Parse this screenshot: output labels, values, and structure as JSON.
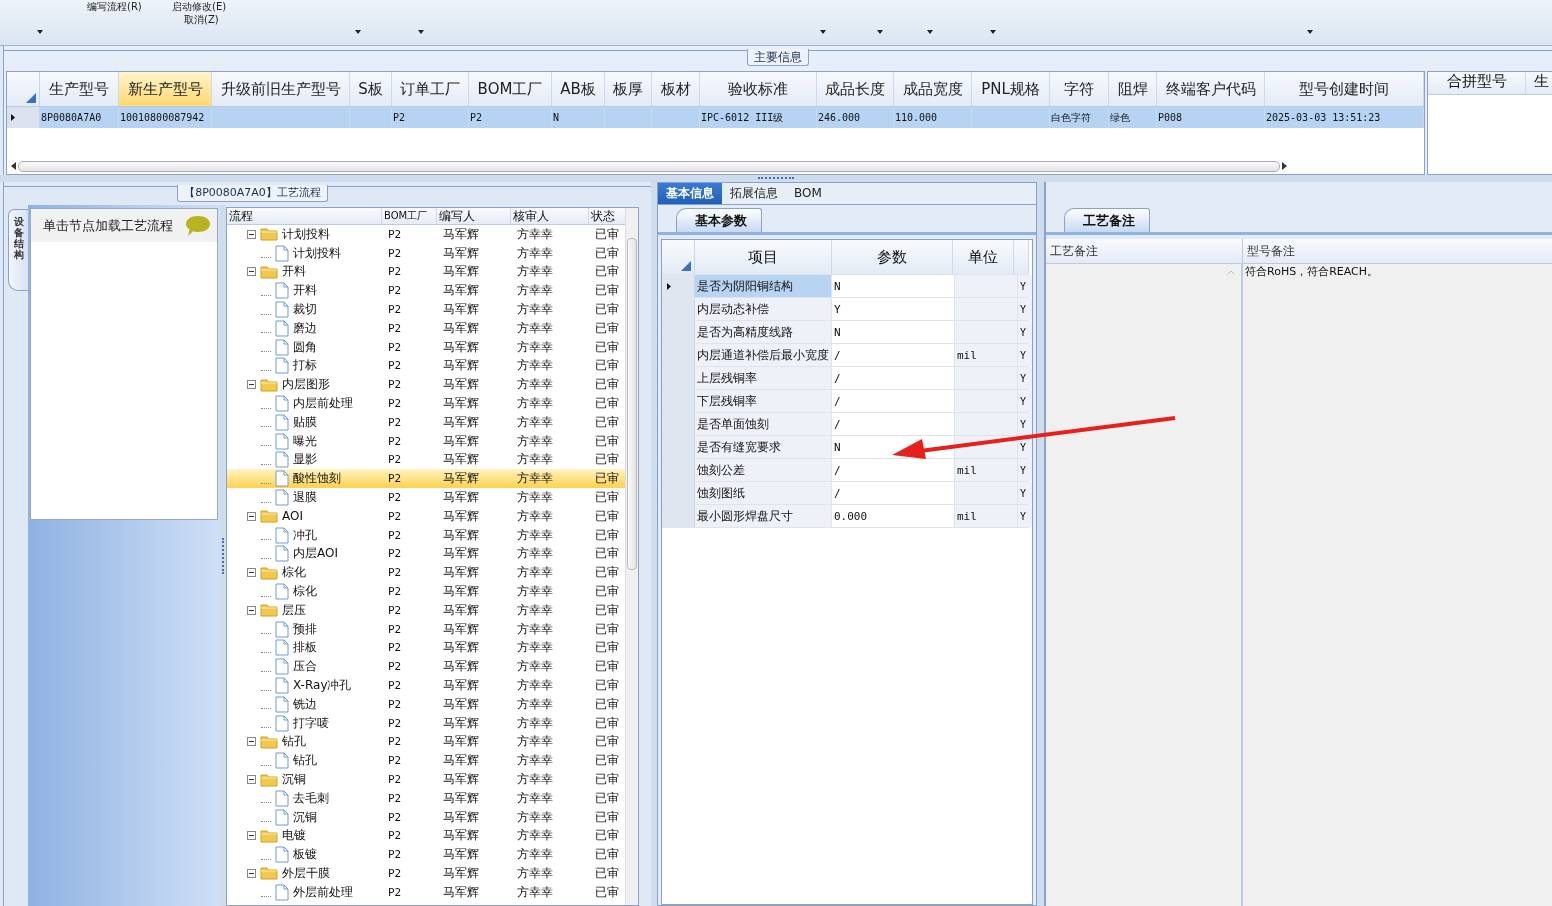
{
  "toolbar": {
    "items": [
      {
        "label": "编写流程(R)"
      },
      {
        "label": "启动修改(E)"
      },
      {
        "label": "取消(Z)"
      }
    ]
  },
  "main_info": {
    "title": "主要信息",
    "columns": [
      {
        "label": "生产型号",
        "selected": false
      },
      {
        "label": "新生产型号",
        "selected": true
      },
      {
        "label": "升级前旧生产型号",
        "selected": false
      },
      {
        "label": "S板",
        "selected": false
      },
      {
        "label": "订单工厂",
        "selected": false
      },
      {
        "label": "BOM工厂",
        "selected": false
      },
      {
        "label": "AB板",
        "selected": false
      },
      {
        "label": "板厚",
        "selected": false
      },
      {
        "label": "板材",
        "selected": false
      },
      {
        "label": "验收标准",
        "selected": false
      },
      {
        "label": "成品长度",
        "selected": false
      },
      {
        "label": "成品宽度",
        "selected": false
      },
      {
        "label": "PNL规格",
        "selected": false
      },
      {
        "label": "字符",
        "selected": false
      },
      {
        "label": "阻焊",
        "selected": false
      },
      {
        "label": "终端客户代码",
        "selected": false
      },
      {
        "label": "型号创建时间",
        "selected": false
      }
    ],
    "rows": [
      {
        "selected": true,
        "cells": [
          "8P0080A7A0",
          "10010800087942",
          null,
          null,
          "P2",
          "P2",
          "N",
          null,
          null,
          "IPC-6012 III级",
          "246.000",
          "110.000",
          null,
          "白色字符",
          "绿色",
          "P008",
          "2025-03-03 13:51:23"
        ]
      }
    ],
    "side_columns": [
      "合拼型号",
      "生"
    ]
  },
  "process_panel": {
    "title": "【8P0080A7A0】工艺流程",
    "side_tab": "设备结构",
    "hint": "单击节点加载工艺流程",
    "tree": {
      "columns": [
        "流程",
        "BOM工厂",
        "编写人",
        "核审人",
        "状态"
      ],
      "rows": [
        {
          "name": "计划投料",
          "bom_factory": "P2",
          "author": "马军辉",
          "reviewer": "方幸幸",
          "status": "已审",
          "selected": false,
          "expanded": true,
          "children": [
            {
              "name": "计划投料",
              "bom_factory": "P2",
              "author": "马军辉",
              "reviewer": "方幸幸",
              "status": "已审",
              "selected": false
            }
          ]
        },
        {
          "name": "开料",
          "bom_factory": "P2",
          "author": "马军辉",
          "reviewer": "方幸幸",
          "status": "已审",
          "selected": false,
          "expanded": true,
          "children": [
            {
              "name": "开料",
              "bom_factory": "P2",
              "author": "马军辉",
              "reviewer": "方幸幸",
              "status": "已审",
              "selected": false
            },
            {
              "name": "裁切",
              "bom_factory": "P2",
              "author": "马军辉",
              "reviewer": "方幸幸",
              "status": "已审",
              "selected": false
            },
            {
              "name": "磨边",
              "bom_factory": "P2",
              "author": "马军辉",
              "reviewer": "方幸幸",
              "status": "已审",
              "selected": false
            },
            {
              "name": "圆角",
              "bom_factory": "P2",
              "author": "马军辉",
              "reviewer": "方幸幸",
              "status": "已审",
              "selected": false
            },
            {
              "name": "打标",
              "bom_factory": "P2",
              "author": "马军辉",
              "reviewer": "方幸幸",
              "status": "已审",
              "selected": false
            }
          ]
        },
        {
          "name": "内层图形",
          "bom_factory": "P2",
          "author": "马军辉",
          "reviewer": "方幸幸",
          "status": "已审",
          "selected": false,
          "expanded": true,
          "children": [
            {
              "name": "内层前处理",
              "bom_factory": "P2",
              "author": "马军辉",
              "reviewer": "方幸幸",
              "status": "已审",
              "selected": false
            },
            {
              "name": "贴膜",
              "bom_factory": "P2",
              "author": "马军辉",
              "reviewer": "方幸幸",
              "status": "已审",
              "selected": false
            },
            {
              "name": "曝光",
              "bom_factory": "P2",
              "author": "马军辉",
              "reviewer": "方幸幸",
              "status": "已审",
              "selected": false
            },
            {
              "name": "显影",
              "bom_factory": "P2",
              "author": "马军辉",
              "reviewer": "方幸幸",
              "status": "已审",
              "selected": false
            },
            {
              "name": "酸性蚀刻",
              "bom_factory": "P2",
              "author": "马军辉",
              "reviewer": "方幸幸",
              "status": "已审",
              "selected": true
            },
            {
              "name": "退膜",
              "bom_factory": "P2",
              "author": "马军辉",
              "reviewer": "方幸幸",
              "status": "已审",
              "selected": false
            }
          ]
        },
        {
          "name": "AOI",
          "bom_factory": "P2",
          "author": "马军辉",
          "reviewer": "方幸幸",
          "status": "已审",
          "selected": false,
          "expanded": true,
          "children": [
            {
              "name": "冲孔",
              "bom_factory": "P2",
              "author": "马军辉",
              "reviewer": "方幸幸",
              "status": "已审",
              "selected": false
            },
            {
              "name": "内层AOI",
              "bom_factory": "P2",
              "author": "马军辉",
              "reviewer": "方幸幸",
              "status": "已审",
              "selected": false
            }
          ]
        },
        {
          "name": "棕化",
          "bom_factory": "P2",
          "author": "马军辉",
          "reviewer": "方幸幸",
          "status": "已审",
          "selected": false,
          "expanded": true,
          "children": [
            {
              "name": "棕化",
              "bom_factory": "P2",
              "author": "马军辉",
              "reviewer": "方幸幸",
              "status": "已审",
              "selected": false
            }
          ]
        },
        {
          "name": "层压",
          "bom_factory": "P2",
          "author": "马军辉",
          "reviewer": "方幸幸",
          "status": "已审",
          "selected": false,
          "expanded": true,
          "children": [
            {
              "name": "预排",
              "bom_factory": "P2",
              "author": "马军辉",
              "reviewer": "方幸幸",
              "status": "已审",
              "selected": false
            },
            {
              "name": "排板",
              "bom_factory": "P2",
              "author": "马军辉",
              "reviewer": "方幸幸",
              "status": "已审",
              "selected": false
            },
            {
              "name": "压合",
              "bom_factory": "P2",
              "author": "马军辉",
              "reviewer": "方幸幸",
              "status": "已审",
              "selected": false
            },
            {
              "name": "X-Ray冲孔",
              "bom_factory": "P2",
              "author": "马军辉",
              "reviewer": "方幸幸",
              "status": "已审",
              "selected": false
            },
            {
              "name": "铣边",
              "bom_factory": "P2",
              "author": "马军辉",
              "reviewer": "方幸幸",
              "status": "已审",
              "selected": false
            },
            {
              "name": "打字唛",
              "bom_factory": "P2",
              "author": "马军辉",
              "reviewer": "方幸幸",
              "status": "已审",
              "selected": false
            }
          ]
        },
        {
          "name": "钻孔",
          "bom_factory": "P2",
          "author": "马军辉",
          "reviewer": "方幸幸",
          "status": "已审",
          "selected": false,
          "expanded": true,
          "children": [
            {
              "name": "钻孔",
              "bom_factory": "P2",
              "author": "马军辉",
              "reviewer": "方幸幸",
              "status": "已审",
              "selected": false
            }
          ]
        },
        {
          "name": "沉铜",
          "bom_factory": "P2",
          "author": "马军辉",
          "reviewer": "方幸幸",
          "status": "已审",
          "selected": false,
          "expanded": true,
          "children": [
            {
              "name": "去毛刺",
              "bom_factory": "P2",
              "author": "马军辉",
              "reviewer": "方幸幸",
              "status": "已审",
              "selected": false
            },
            {
              "name": "沉铜",
              "bom_factory": "P2",
              "author": "马军辉",
              "reviewer": "方幸幸",
              "status": "已审",
              "selected": false
            }
          ]
        },
        {
          "name": "电镀",
          "bom_factory": "P2",
          "author": "马军辉",
          "reviewer": "方幸幸",
          "status": "已审",
          "selected": false,
          "expanded": true,
          "children": [
            {
              "name": "板镀",
              "bom_factory": "P2",
              "author": "马军辉",
              "reviewer": "方幸幸",
              "status": "已审",
              "selected": false
            }
          ]
        },
        {
          "name": "外层干膜",
          "bom_factory": "P2",
          "author": "马军辉",
          "reviewer": "方幸幸",
          "status": "已审",
          "selected": false,
          "expanded": true,
          "children": [
            {
              "name": "外层前处理",
              "bom_factory": "P2",
              "author": "马军辉",
              "reviewer": "方幸幸",
              "status": "已审",
              "selected": false
            }
          ]
        }
      ]
    }
  },
  "info_panel": {
    "tabs": [
      {
        "label": "基本信息",
        "selected": true
      },
      {
        "label": "拓展信息",
        "selected": false
      },
      {
        "label": "BOM",
        "selected": false
      }
    ],
    "sub_tab": "基本参数",
    "columns": [
      "项目",
      "参数",
      "单位"
    ],
    "rows": [
      {
        "item": "是否为阴阳铜结构",
        "value": "N",
        "flag": "Y",
        "selected": true
      },
      {
        "item": "内层动态补偿",
        "value": "Y",
        "flag": "Y",
        "selected": false
      },
      {
        "item": "是否为高精度线路",
        "value": "N",
        "flag": "Y",
        "selected": false
      },
      {
        "item": "内层通道补偿后最小宽度",
        "value": "/",
        "unit": "mil",
        "flag": "Y",
        "selected": false
      },
      {
        "item": "上层残铜率",
        "value": "/",
        "flag": "Y",
        "selected": false
      },
      {
        "item": "下层残铜率",
        "value": "/",
        "flag": "Y",
        "selected": false
      },
      {
        "item": "是否单面蚀刻",
        "value": "/",
        "flag": "Y",
        "selected": false
      },
      {
        "item": "是否有缝宽要求",
        "value": "N",
        "flag": "Y",
        "selected": false
      },
      {
        "item": "蚀刻公差",
        "value": "/",
        "unit": "mil",
        "flag": "Y",
        "selected": false
      },
      {
        "item": "蚀刻图纸",
        "value": "/",
        "flag": "Y",
        "selected": false
      },
      {
        "item": "最小圆形焊盘尺寸",
        "value": "0.000",
        "unit": "mil",
        "flag": "Y",
        "selected": false
      }
    ]
  },
  "notes_panel": {
    "tab": "工艺备注",
    "columns": [
      "工艺备注",
      "型号备注"
    ],
    "model_note": "符合RoHS，符合REACH。"
  }
}
